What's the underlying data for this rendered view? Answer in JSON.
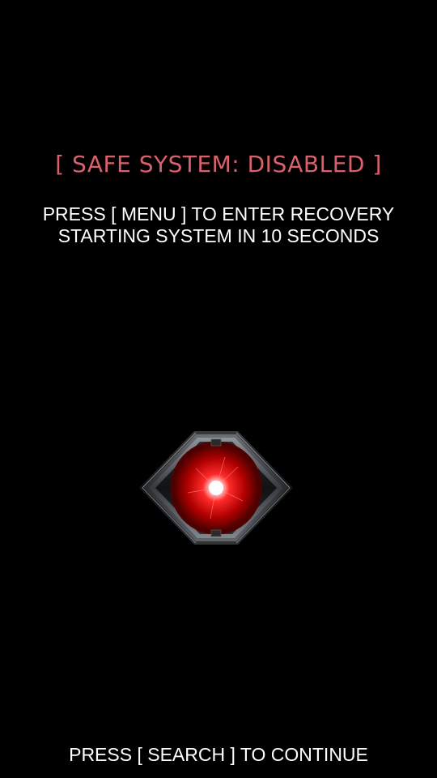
{
  "screen": {
    "status_text": "[ SAFE SYSTEM: DISABLED ]",
    "instructions": [
      "PRESS [ MENU ] TO ENTER RECOVERY",
      "STARTING SYSTEM IN 10 SECONDS"
    ],
    "footer_text": "PRESS [ SEARCH ] TO CONTINUE"
  },
  "colors": {
    "background": "#000000",
    "status_text": "#d9606c",
    "body_text": "#ffffff",
    "eye_glow": "#ff2020"
  },
  "icons": {
    "center_logo": "droid-eye-icon"
  }
}
